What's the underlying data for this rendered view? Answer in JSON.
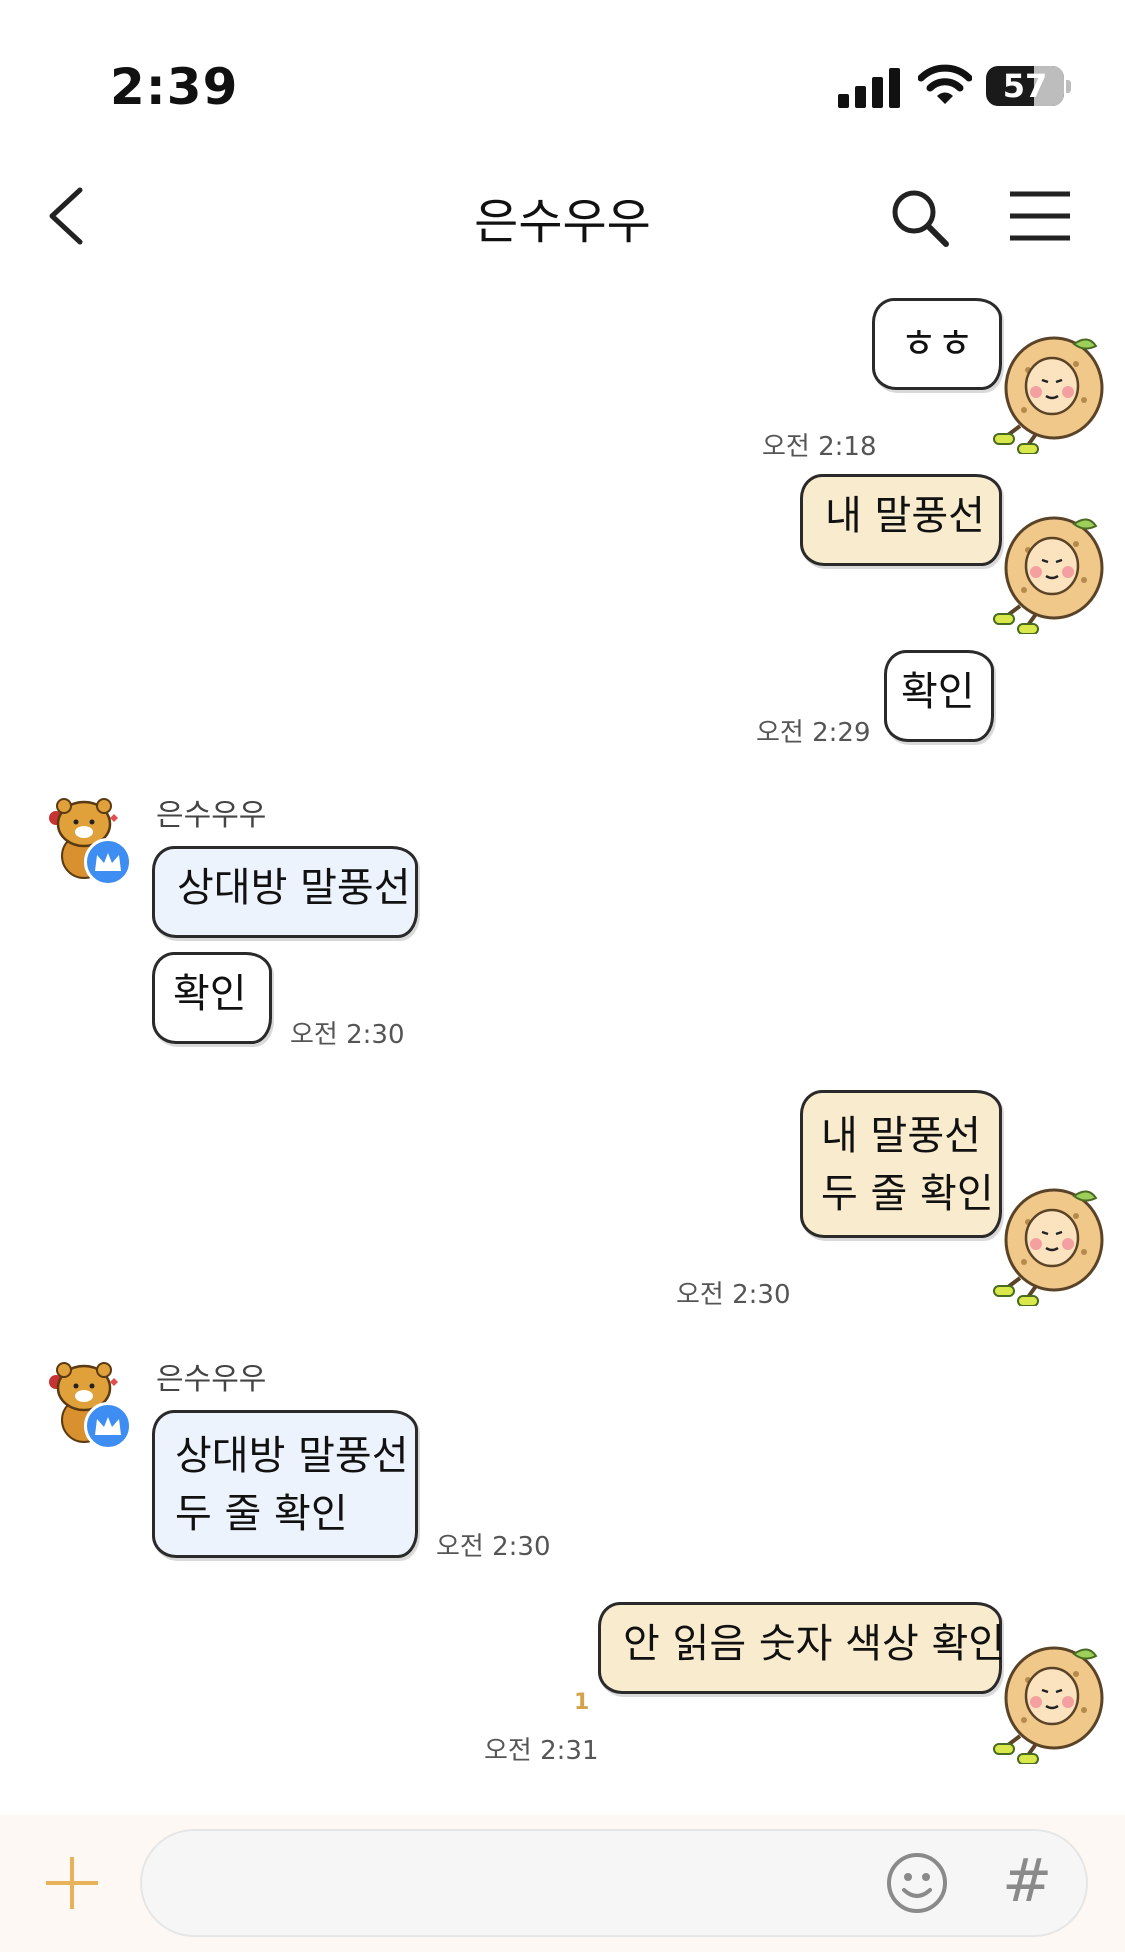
{
  "status_bar": {
    "time": "2:39",
    "battery": "57"
  },
  "header": {
    "title": "은수우우"
  },
  "messages": {
    "m1": {
      "text": "ㅎㅎ",
      "time": "오전 2:18"
    },
    "m2": {
      "text": "내 말풍선"
    },
    "m3": {
      "text": "확인",
      "time": "오전 2:29"
    },
    "m4": {
      "sender": "은수우우",
      "text": "상대방 말풍선"
    },
    "m5": {
      "text": "확인",
      "time": "오전 2:30"
    },
    "m6": {
      "line1": "내 말풍선",
      "line2": "두 줄 확인",
      "time": "오전 2:30"
    },
    "m7": {
      "sender": "은수우우",
      "line1": "상대방 말풍선",
      "line2": "두 줄 확인",
      "time": "오전 2:30"
    },
    "m8": {
      "text": "안 읽음 숫자 색상 확인",
      "unread": "1",
      "time": "오전 2:31"
    }
  },
  "input_bar": {
    "placeholder": ""
  },
  "colors": {
    "my_bubble": "#f8ebce",
    "their_bubble": "#edf3fc",
    "unread_count": "#d4a24a",
    "crown_badge": "#3d8df2"
  },
  "icons": [
    "back-icon",
    "search-icon",
    "menu-icon",
    "plus-icon",
    "emoji-icon",
    "hashtag-icon",
    "crown-icon"
  ]
}
